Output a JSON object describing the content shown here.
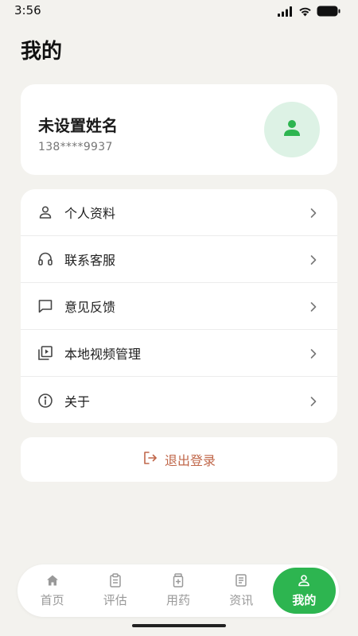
{
  "status_bar": {
    "time": "3:56"
  },
  "page_title": "我的",
  "profile": {
    "name": "未设置姓名",
    "phone": "138****9937"
  },
  "menu": [
    {
      "label": "个人资料",
      "icon": "person-icon"
    },
    {
      "label": "联系客服",
      "icon": "headset-icon"
    },
    {
      "label": "意见反馈",
      "icon": "message-icon"
    },
    {
      "label": "本地视频管理",
      "icon": "video-library-icon"
    },
    {
      "label": "关于",
      "icon": "info-icon"
    }
  ],
  "logout": {
    "label": "退出登录",
    "icon": "logout-icon"
  },
  "tabs": [
    {
      "label": "首页",
      "icon": "home-icon",
      "active": false
    },
    {
      "label": "评估",
      "icon": "clipboard-icon",
      "active": false
    },
    {
      "label": "用药",
      "icon": "medicine-icon",
      "active": false
    },
    {
      "label": "资讯",
      "icon": "article-icon",
      "active": false
    },
    {
      "label": "我的",
      "icon": "user-icon",
      "active": true
    }
  ],
  "colors": {
    "background": "#F3F2EE",
    "accent_green": "#2DB550",
    "avatar_bg": "#DDF2E5",
    "logout_text": "#C0674A"
  }
}
